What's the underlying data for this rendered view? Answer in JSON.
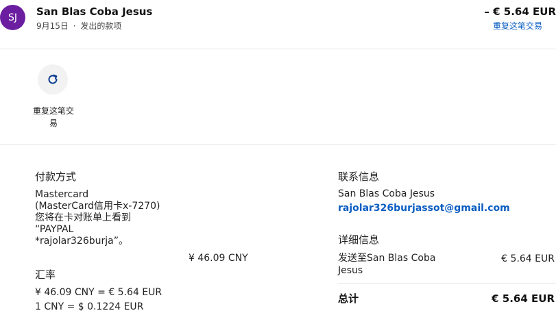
{
  "header": {
    "avatar_initials": "SJ",
    "merchant_name": "San Blas Coba Jesus",
    "date": "9月15日",
    "separator": "·",
    "type": "发出的款项",
    "amount": "– € 5.64 EUR",
    "repeat_link": "重复这笔交易"
  },
  "actions": {
    "repeat_icon": "refresh-icon",
    "repeat_label": "重复这笔交易"
  },
  "payment": {
    "title": "付款方式",
    "lines": [
      "Mastercard",
      "(MasterCard信用卡x-7270)",
      "您将在卡对账单上看到",
      "“PAYPAL",
      "*rajolar326burja”。"
    ],
    "amount_cny": "¥ 46.09 CNY"
  },
  "exchange": {
    "title": "汇率",
    "line1": "¥ 46.09 CNY = € 5.64 EUR",
    "line2": "1 CNY = $ 0.1224 EUR"
  },
  "contact": {
    "title": "联系信息",
    "name": "San Blas Coba Jesus",
    "email": "rajolar326burjassot@gmail.com"
  },
  "details": {
    "title": "详细信息",
    "sent_to_label": "发送至San Blas Coba Jesus",
    "sent_to_amount": "€ 5.64 EUR",
    "total_label": "总计",
    "total_amount": "€ 5.64 EUR"
  },
  "colors": {
    "avatar_bg": "#6b1fa0",
    "link": "#0a5dc2"
  }
}
